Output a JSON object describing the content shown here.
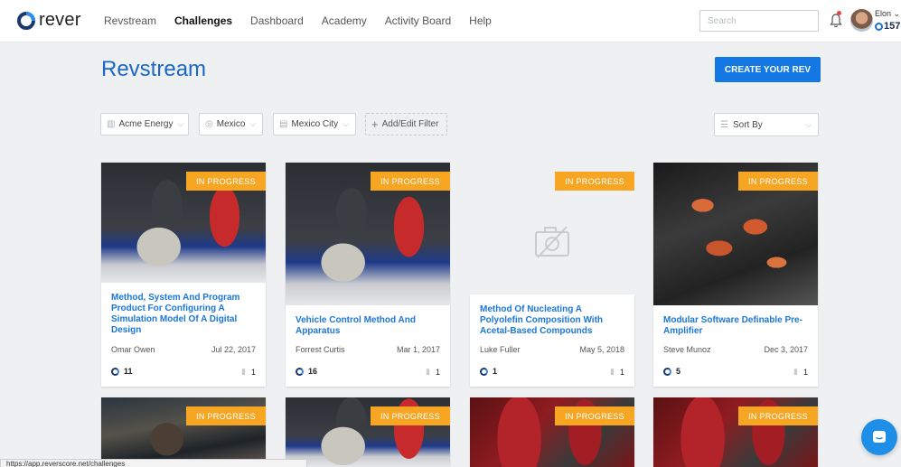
{
  "app": {
    "logo_text": "rever",
    "nav": [
      {
        "label": "Revstream",
        "active": false
      },
      {
        "label": "Challenges",
        "active": true
      },
      {
        "label": "Dashboard",
        "active": false
      },
      {
        "label": "Academy",
        "active": false
      },
      {
        "label": "Activity Board",
        "active": false
      },
      {
        "label": "Help",
        "active": false
      }
    ],
    "search_placeholder": "Search",
    "user": {
      "name": "Elon",
      "points": "157"
    }
  },
  "page": {
    "title": "Revstream",
    "create_button": "CREATE YOUR REV"
  },
  "filters": {
    "items": [
      {
        "label": "Acme Energy",
        "icon": "bar-chart-icon"
      },
      {
        "label": "Mexico",
        "icon": "globe-icon"
      },
      {
        "label": "Mexico City",
        "icon": "building-icon"
      }
    ],
    "add_label": "Add/Edit Filter",
    "sort_label": "Sort By"
  },
  "cards": [
    {
      "status": "IN PROGRESS",
      "title": "Method, System And Program Product For Configuring A Simulation Model Of A Digital Design",
      "author": "Omar Owen",
      "date": "Jul 22, 2017",
      "count": "11",
      "likes": "1",
      "image": "photo"
    },
    {
      "status": "IN PROGRESS",
      "title": "Vehicle Control Method And Apparatus",
      "author": "Forrest Curtis",
      "date": "Mar 1, 2017",
      "count": "16",
      "likes": "1",
      "image": "photo"
    },
    {
      "status": "IN PROGRESS",
      "title": "Method Of Nucleating A Polyolefin Composition With Acetal-Based Compounds",
      "author": "Luke Fuller",
      "date": "May 5, 2018",
      "count": "1",
      "likes": "1",
      "image": "no-image-icon"
    },
    {
      "status": "IN PROGRESS",
      "title": "Modular Software Definable Pre-Amplifier",
      "author": "Steve Munoz",
      "date": "Dec 3, 2017",
      "count": "5",
      "likes": "1",
      "image": "photo"
    }
  ],
  "row2_cards": [
    {
      "status": "IN PROGRESS"
    },
    {
      "status": "IN PROGRESS"
    },
    {
      "status": "IN PROGRESS"
    },
    {
      "status": "IN PROGRESS"
    }
  ],
  "status_url": "https://app.reverscore.net/challenges"
}
